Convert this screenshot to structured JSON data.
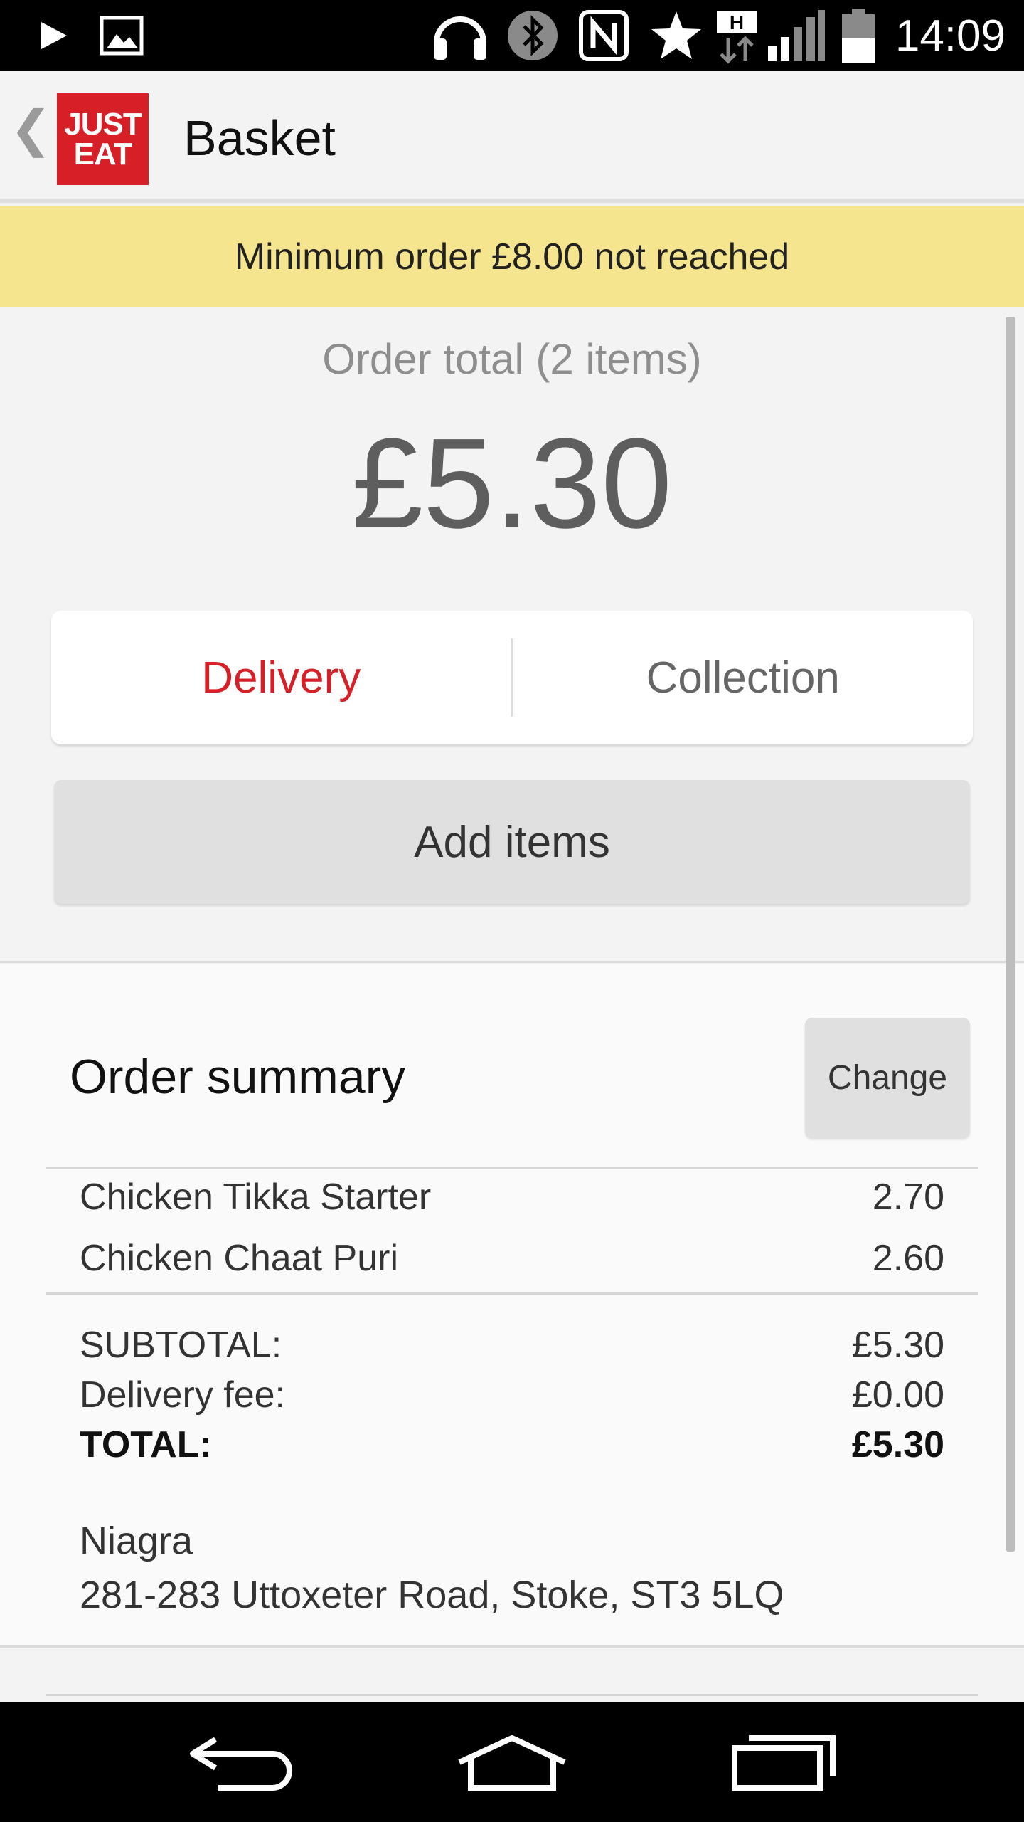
{
  "status_bar": {
    "time": "14:09",
    "icons": [
      "play-icon",
      "image-icon",
      "headset-icon",
      "bluetooth-icon",
      "nfc-icon",
      "star-icon",
      "hspa-icon",
      "signal-icon",
      "battery-icon"
    ]
  },
  "app_bar": {
    "back_glyph": "❮",
    "logo_line1": "JUST",
    "logo_line2": "EAT",
    "title": "Basket"
  },
  "banner": {
    "message": "Minimum order £8.00 not reached"
  },
  "order_total": {
    "label": "Order total (2 items)",
    "amount": "£5.30"
  },
  "fulfilment": {
    "delivery_label": "Delivery",
    "collection_label": "Collection",
    "selected": "Delivery"
  },
  "add_items_label": "Add items",
  "summary": {
    "title": "Order summary",
    "change_label": "Change",
    "items": [
      {
        "name": "Chicken Tikka Starter",
        "price": "2.70"
      },
      {
        "name": "Chicken Chaat Puri",
        "price": "2.60"
      }
    ],
    "subtotal_label": "SUBTOTAL:",
    "subtotal_value": "£5.30",
    "delivery_fee_label": "Delivery fee:",
    "delivery_fee_value": "£0.00",
    "total_label": "TOTAL:",
    "total_value": "£5.30",
    "restaurant_name": "Niagra",
    "restaurant_address": "281-283 Uttoxeter Road, Stoke, ST3 5LQ"
  },
  "nav_bar": {
    "icons": [
      "back-icon",
      "home-icon",
      "recent-apps-icon"
    ]
  },
  "colors": {
    "brand_red": "#d61f26",
    "banner_yellow": "#f6e58f"
  }
}
